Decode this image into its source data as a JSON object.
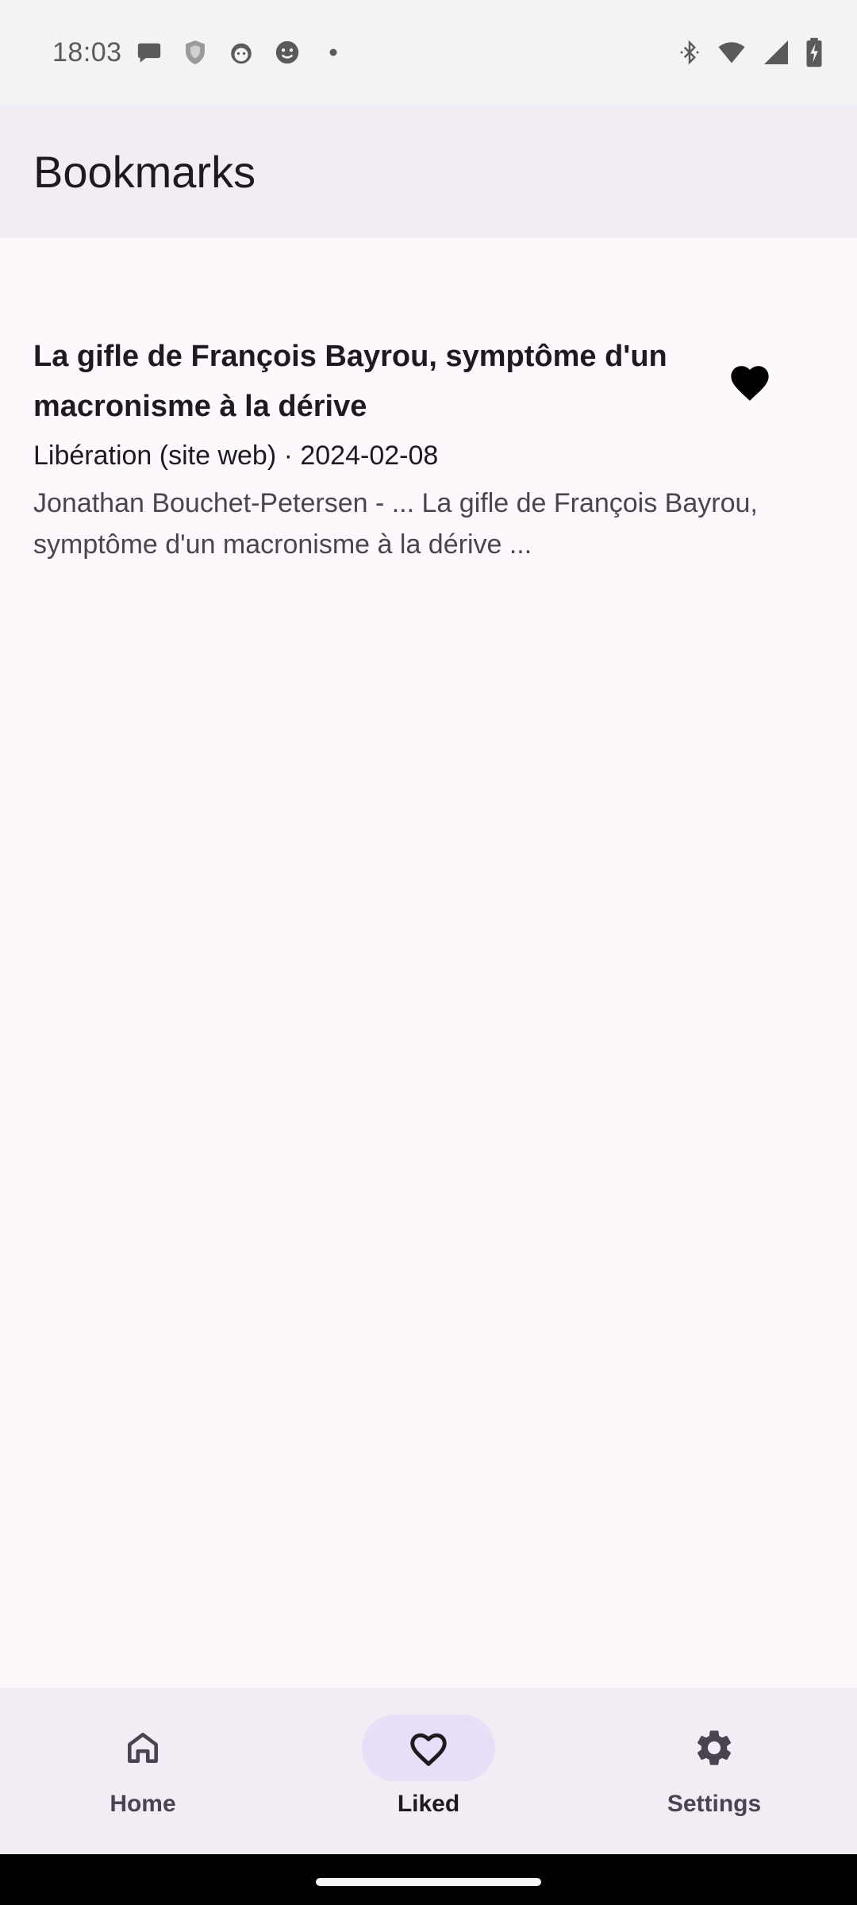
{
  "status_bar": {
    "time": "18:03",
    "notification_icons": [
      "chat-bubble-icon",
      "shield-app-icon",
      "cat-face-icon",
      "smile-face-icon",
      "dot-icon"
    ],
    "system_icons": [
      "bluetooth-icon",
      "wifi-icon",
      "cellular-signal-icon",
      "battery-charging-icon"
    ]
  },
  "app_bar": {
    "title": "Bookmarks"
  },
  "bookmarks": [
    {
      "title": "La gifle de François Bayrou, symptôme d'un macronisme à la dérive",
      "meta": "Libération (site web) · 2024-02-08",
      "snippet": "Jonathan Bouchet-Petersen - ... La gifle de François Bayrou, symptôme d'un macronisme à la dérive ...",
      "liked": true
    }
  ],
  "bottom_nav": {
    "items": [
      {
        "label": "Home",
        "icon": "home-icon",
        "active": false
      },
      {
        "label": "Liked",
        "icon": "heart-outline-icon",
        "active": true
      },
      {
        "label": "Settings",
        "icon": "gear-icon",
        "active": false
      }
    ]
  },
  "colors": {
    "app_bar_bg": "#f2ecf5",
    "background": "#fdf8fc",
    "active_indicator": "#e8def8",
    "text_primary": "#1d1b20",
    "text_secondary": "#49454f"
  }
}
